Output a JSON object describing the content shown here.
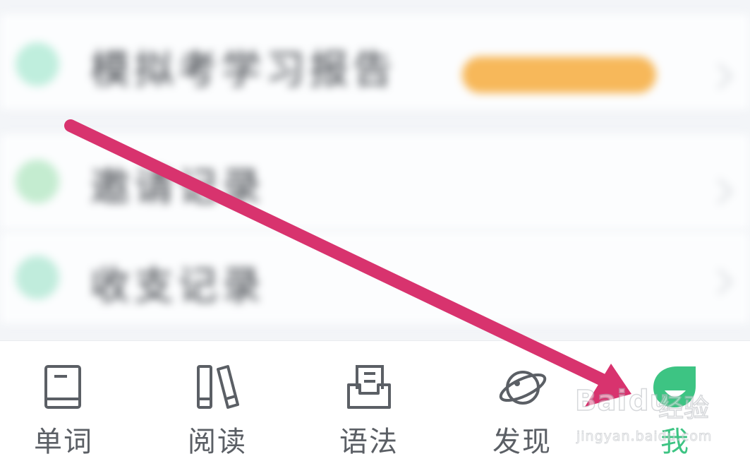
{
  "list": {
    "rows": [
      {
        "label": "模拟考学习报告",
        "has_badge": true,
        "icon_color": "#bfeedd"
      },
      {
        "label": "邀请记录",
        "has_badge": false,
        "icon_color": "#c4ecd0"
      },
      {
        "label": "收支记录",
        "has_badge": false,
        "icon_color": "#c0ecdc"
      }
    ],
    "badge_color": "#f7b85a"
  },
  "tabbar": {
    "tabs": [
      {
        "label": "单词",
        "icon": "book-icon"
      },
      {
        "label": "阅读",
        "icon": "books-icon"
      },
      {
        "label": "语法",
        "icon": "document-tray-icon"
      },
      {
        "label": "发现",
        "icon": "planet-icon"
      },
      {
        "label": "我",
        "icon": "me-leaf-face-icon",
        "active": true
      }
    ],
    "active_color": "#3dc483",
    "inactive_color": "#5b5f65"
  },
  "annotation": {
    "arrow_color": "#d8336e"
  },
  "watermark": {
    "brand": "Bai",
    "brand_suffix": "du",
    "brand_cn": "经验",
    "site": "jingyan.baidu.com"
  }
}
